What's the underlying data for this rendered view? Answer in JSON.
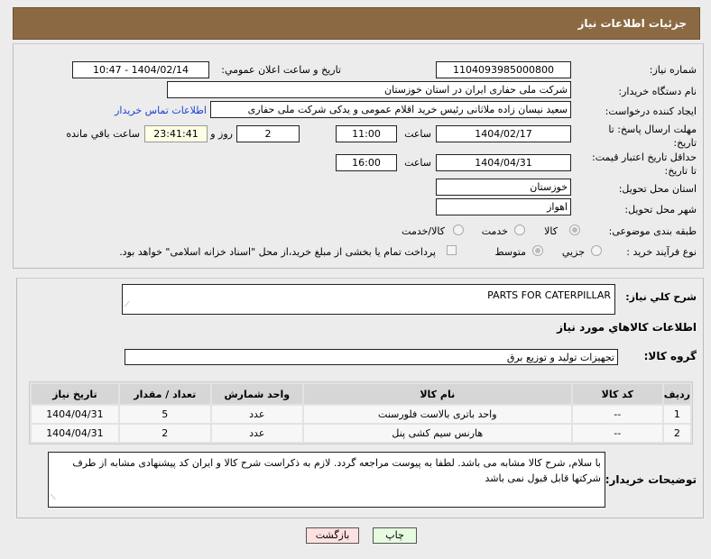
{
  "header": {
    "title": "جزئیات اطلاعات نیاز"
  },
  "form": {
    "need_number_label": "شماره نیاز:",
    "need_number": "1104093985000800",
    "announce_label": "تاریخ و ساعت اعلان عمومي:",
    "announce_value": "1404/02/14 - 10:47",
    "buyer_org_label": "نام دستگاه خریدار:",
    "buyer_org": "شرکت ملی حفاری ایران در استان خوزستان",
    "creator_label": "ایجاد کننده درخواست:",
    "creator": "سعید نیسان زاده ملاثانی رئیس خرید اقلام عمومی و یدکی شرکت ملی حفاری",
    "contact_link": "اطلاعات تماس خریدار",
    "deadline_label": "مهلت ارسال پاسخ: تا تاریخ:",
    "deadline_date": "1404/02/17",
    "time_label": "ساعت",
    "deadline_time": "11:00",
    "days": "2",
    "days_label": "روز و",
    "remaining": "23:41:41",
    "remaining_label": "ساعت باقي مانده",
    "validity_label": "حداقل تاریخ اعتبار قیمت: تا تاریخ:",
    "validity_date": "1404/04/31",
    "validity_time": "16:00",
    "province_label": "استان محل تحویل:",
    "province": "خوزستان",
    "city_label": "شهر محل تحویل:",
    "city": "اهواز",
    "category_label": "طبقه بندی موضوعی:",
    "category_options": [
      "کالا",
      "خدمت",
      "کالا/خدمت"
    ],
    "process_label": "نوع فرآیند خرید :",
    "process_options": [
      "جزیي",
      "متوسط"
    ],
    "payment_note": "پرداخت تمام یا بخشی از مبلغ خرید،از محل \"اسناد خزانه اسلامی\" خواهد بود."
  },
  "details": {
    "summary_label": "شرح کلي نیاز:",
    "summary": "PARTS FOR CATERPILLAR",
    "items_title": "اطلاعات کالاهاي مورد نیاز",
    "group_label": "گروه کالا:",
    "group": "تجهیزات تولید و توزیع برق",
    "table": {
      "headers": [
        "ردیف",
        "کد کالا",
        "نام کالا",
        "واحد شمارش",
        "تعداد / مقدار",
        "تاریخ نیاز"
      ],
      "rows": [
        [
          "1",
          "--",
          "واحد باتری بالاست فلورسنت",
          "عدد",
          "5",
          "1404/04/31"
        ],
        [
          "2",
          "--",
          "هارنس سیم کشی پنل",
          "عدد",
          "2",
          "1404/04/31"
        ]
      ]
    },
    "notes_label": "توضیحات خریدار:",
    "notes": "با سلام, شرح کالا مشابه می باشد. لطفا به پیوست مراجعه گردد. لازم به ذکراست شرح کالا و ایران کد  پیشنهادی مشابه از طرف شرکتها قابل قبول نمی باشد"
  },
  "buttons": {
    "print": "چاپ",
    "back": "بازگشت"
  }
}
